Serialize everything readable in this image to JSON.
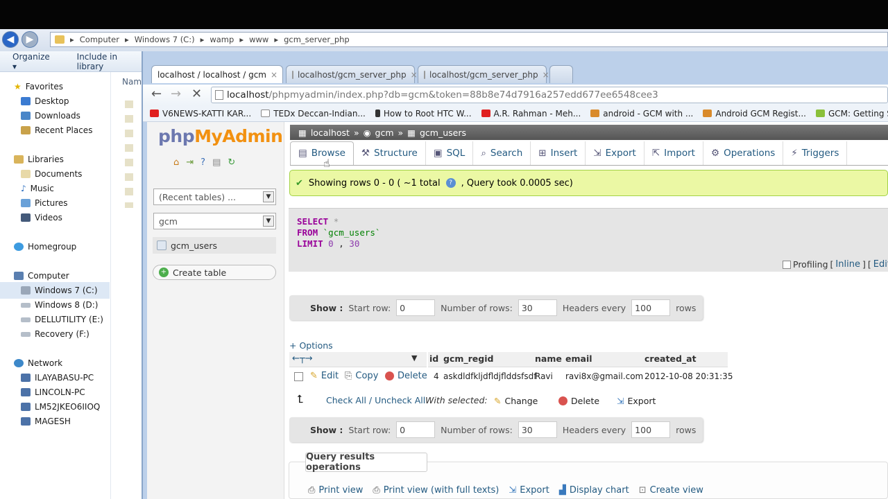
{
  "explorer": {
    "breadcrumb": [
      "Computer",
      "Windows 7 (C:)",
      "wamp",
      "www",
      "gcm_server_php"
    ],
    "toolbar": {
      "organize": "Organize",
      "include": "Include in library"
    },
    "column_header": "Nam",
    "nav": {
      "favorites": "Favorites",
      "desktop": "Desktop",
      "downloads": "Downloads",
      "recent": "Recent Places",
      "libraries": "Libraries",
      "documents": "Documents",
      "music": "Music",
      "pictures": "Pictures",
      "videos": "Videos",
      "homegroup": "Homegroup",
      "computer": "Computer",
      "win7": "Windows 7 (C:)",
      "win8": "Windows 8 (D:)",
      "dellutility": "DELLUTILITY (E:)",
      "recovery": "Recovery (F:)",
      "network": "Network",
      "pc1": "ILAYABASU-PC",
      "pc2": "LINCOLN-PC",
      "pc3": "LM52JKEO6IIOQ",
      "pc4": "MAGESH"
    }
  },
  "browser": {
    "tabs": [
      "localhost / localhost / gcm",
      "localhost/gcm_server_php",
      "localhost/gcm_server_php"
    ],
    "url_host": "localhost",
    "url_rest": "/phpmyadmin/index.php?db=gcm&token=88b8e74d7916a257edd677ee6548cee3",
    "bookmarks": [
      "V6NEWS-KATTI KAR...",
      "TEDx Deccan-Indian...",
      "How to Root HTC W...",
      "A.R. Rahman - Meh...",
      "android - GCM with ...",
      "Android GCM Regist...",
      "GCM: Getting Starte..."
    ]
  },
  "pma": {
    "logo_php": "php",
    "logo_my": "MyAdmin",
    "recent_tables": "(Recent tables) ...",
    "db_select": "gcm",
    "table_item": "gcm_users",
    "create_table": "Create table",
    "breadcrumb": {
      "server": "localhost",
      "db": "gcm",
      "table": "gcm_users"
    },
    "tabs": [
      "Browse",
      "Structure",
      "SQL",
      "Search",
      "Insert",
      "Export",
      "Import",
      "Operations",
      "Triggers"
    ],
    "success": {
      "text1": "Showing rows 0 - 0 ( ~1 total",
      "text2": ", Query took 0.0005 sec)"
    },
    "sql": {
      "select": "SELECT",
      "star": "*",
      "from": "FROM",
      "table": "`gcm_users`",
      "limit": "LIMIT",
      "offset": "0",
      "comma": ",",
      "count": "30"
    },
    "profiling": {
      "label": "Profiling",
      "inline": "Inline",
      "edit": "Edit",
      "open_bracket": "[",
      "close_bracket": "]"
    },
    "nav_opts": {
      "show": "Show :",
      "start_row_label": "Start row:",
      "start_row": "0",
      "num_rows_label": "Number of rows:",
      "num_rows": "30",
      "headers_label": "Headers every",
      "headers": "100",
      "rows": "rows"
    },
    "options_link": "+ Options",
    "columns": [
      "id",
      "gcm_regid",
      "name",
      "email",
      "created_at"
    ],
    "row": {
      "id": "4",
      "gcm_regid": "askdldfkljdfldjflddsfsdf",
      "name": "Ravi",
      "email": "ravi8x@gmail.com",
      "created_at": "2012-10-08 20:31:35"
    },
    "row_actions": {
      "edit": "Edit",
      "copy": "Copy",
      "delete": "Delete"
    },
    "bulk": {
      "check_all": "Check All / Uncheck All",
      "with_selected": "With selected:",
      "change": "Change",
      "delete": "Delete",
      "export": "Export"
    },
    "qro": {
      "title": "Query results operations",
      "print": "Print view",
      "print_full": "Print view (with full texts)",
      "export": "Export",
      "chart": "Display chart",
      "create_view": "Create view"
    }
  },
  "colors": {
    "pma_link": "#235a81",
    "success_bg": "#ebf8a4",
    "sql_keyword": "#990099"
  }
}
